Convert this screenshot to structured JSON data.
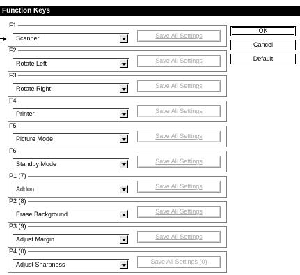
{
  "window": {
    "title": "Function Keys"
  },
  "groups": [
    {
      "legend": "F1",
      "value": "Scanner",
      "save_label": "Save All Settings"
    },
    {
      "legend": "F2",
      "value": "Rotate Left",
      "save_label": "Save All Settings"
    },
    {
      "legend": "F3",
      "value": "Rotate Right",
      "save_label": "Save All Settings"
    },
    {
      "legend": "F4",
      "value": "Printer",
      "save_label": "Save All Settings"
    },
    {
      "legend": "F5",
      "value": "Picture Mode",
      "save_label": "Save All Settings"
    },
    {
      "legend": "F6",
      "value": "Standby Mode",
      "save_label": "Save All Settings"
    },
    {
      "legend": "P1 (7)",
      "value": "Addon",
      "save_label": "Save All Settings"
    },
    {
      "legend": "P2 (8)",
      "value": "Erase Background",
      "save_label": "Save All Settings"
    },
    {
      "legend": "P3 (9)",
      "value": "Adjust Margin",
      "save_label": "Save All Settings"
    },
    {
      "legend": "P4 (0)",
      "value": "Adjust Sharpness",
      "save_label": "Save All Settings (0)"
    }
  ],
  "buttons": {
    "ok": "OK",
    "cancel": "Cancel",
    "default": "Default"
  },
  "icons": {
    "dropdown": "chevron-down-icon",
    "pointer": "arrow-right-icon"
  }
}
